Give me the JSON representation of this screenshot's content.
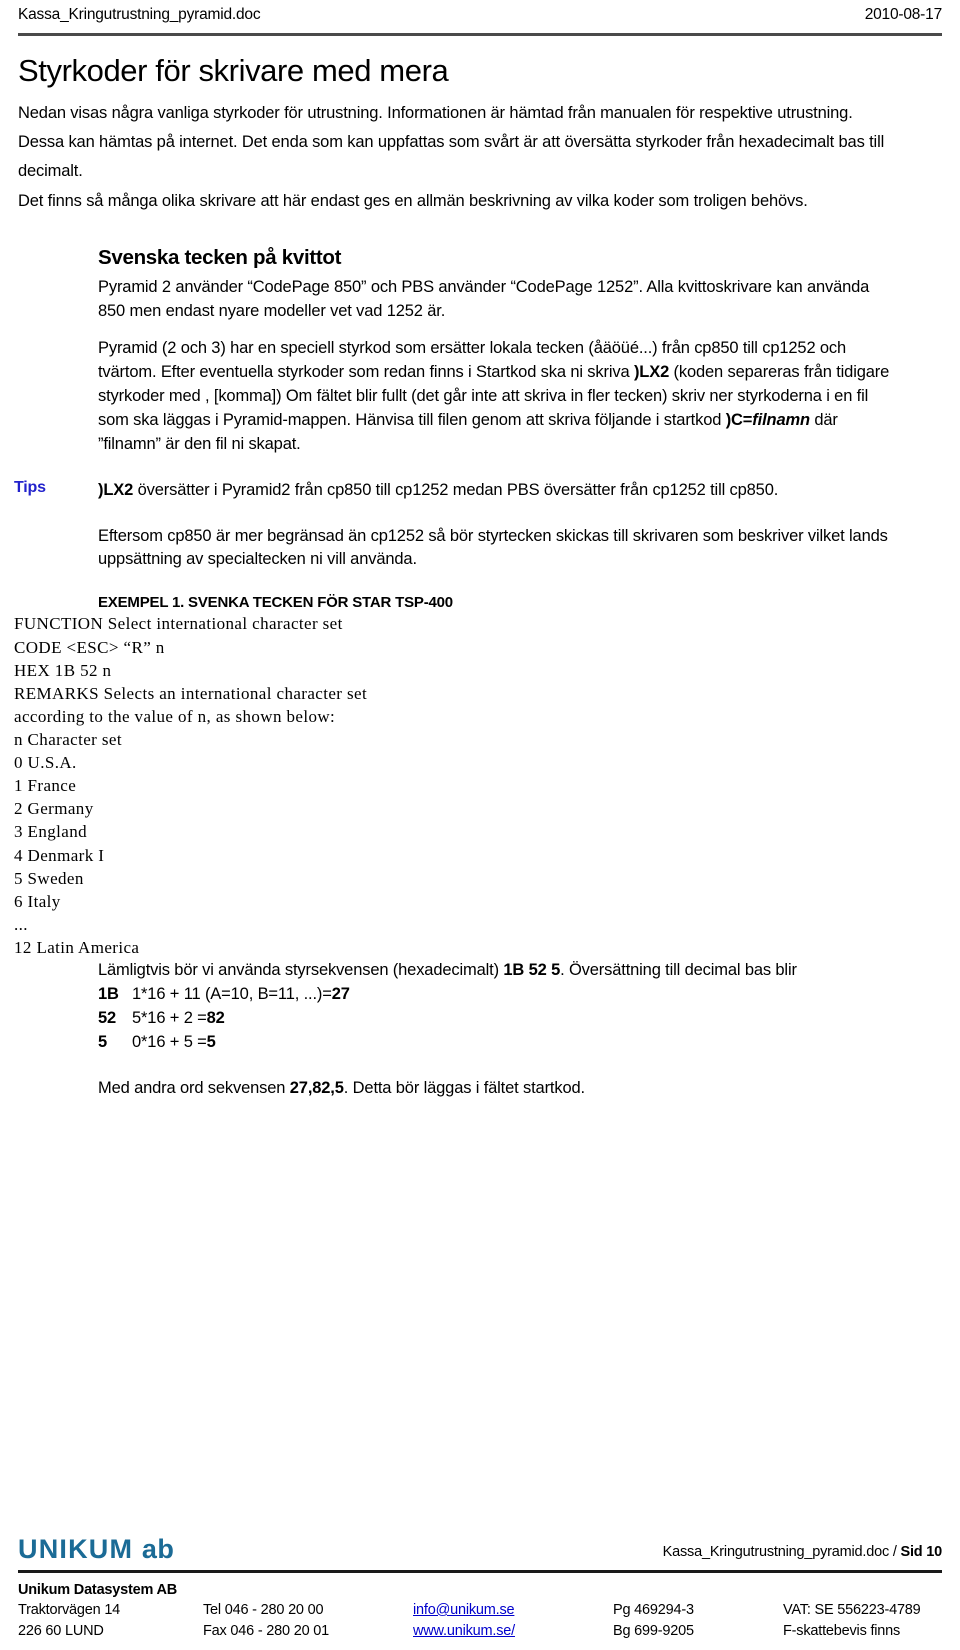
{
  "header": {
    "doc_name": "Kassa_Kringutrustning_pyramid.doc",
    "date": "2010-08-17"
  },
  "title": "Styrkoder för skrivare med mera",
  "intro": {
    "p1": "Nedan visas några vanliga styrkoder för utrustning. Informationen är hämtad från manualen för respektive utrustning. Dessa kan hämtas på internet. Det enda som kan uppfattas som svårt är att översätta styrkoder från hexadecimalt bas till decimalt.",
    "p2": "Det finns så många olika skrivare att här endast ges en allmän beskrivning av vilka koder som troligen behövs."
  },
  "section": {
    "heading": "Svenska tecken på kvittot",
    "p1": "Pyramid 2 använder “CodePage 850” och PBS använder “CodePage 1252”. Alla kvittoskrivare kan använda 850 men endast nyare modeller vet vad 1252 är.",
    "p2_a": "Pyramid (2 och 3) har en speciell styrkod som ersätter lokala tecken (åäöüé...) från cp850 till cp1252 och tvärtom. Efter eventuella styrkoder som redan finns i Startkod ska ni skriva ",
    "p2_b_bold": ")LX2",
    "p2_c": " (koden separeras från tidigare styrkoder med , [komma]) Om fältet blir fullt (det går inte att skriva in fler tecken) skriv ner styrkoderna i en fil som ska läggas i Pyramid-mappen. Hänvisa till filen genom att skriva följande i startkod ",
    "p2_d_bold": ")C=",
    "p2_e_bolditalic": "filnamn",
    "p2_f": " där ”filnamn” är den fil ni skapat."
  },
  "tips": {
    "label": "Tips",
    "p1_bold": ")LX2",
    "p1_rest": " översätter i Pyramid2 från cp850 till cp1252 medan PBS översätter från cp1252 till cp850.",
    "p2": "Eftersom cp850 är mer begränsad än cp1252 så bör styrtecken skickas till skrivaren som beskriver vilket lands uppsättning av specialtecken ni vill använda."
  },
  "example": {
    "heading": "EXEMPEL 1. SVENKA TECKEN FÖR STAR TSP-400",
    "manual_text": "FUNCTION Select international character set\nCODE <ESC> “R” n\nHEX 1B 52 n\nREMARKS Selects an international character set\naccording to the value of n, as shown below:\nn Character set\n0 U.S.A.\n1 France\n2 Germany\n3 England\n4 Denmark I\n5 Sweden\n6 Italy\n...\n12 Latin America",
    "concl_a": "Lämligtvis bör vi använda styrsekvensen (hexadecimalt) ",
    "concl_b_bold": "1B 52 5",
    "concl_c": ". Översättning till decimal bas blir",
    "calc": [
      {
        "key": "1B",
        "expr_a": "1*16 + 11 (A=10, B=11, ...)=",
        "expr_b_bold": "27"
      },
      {
        "key": "52",
        "expr_a": "5*16 + 2 =",
        "expr_b_bold": "82"
      },
      {
        "key": "5",
        "expr_a": "0*16 + 5 =",
        "expr_b_bold": "5"
      }
    ],
    "final_a": "Med andra ord sekvensen ",
    "final_b_bold": "27,82,5",
    "final_c": ". Detta bör läggas i fältet startkod."
  },
  "footer": {
    "logo_main": "UNIKUM",
    "logo_sub": "ab",
    "docref_plain": "Kassa_Kringutrustning_pyramid.doc / ",
    "docref_bold": "Sid 10",
    "company": "Unikum Datasystem AB",
    "rows": [
      {
        "address": "Traktorvägen 14",
        "phone": "Tel  046 - 280 20 00",
        "link": "info@unikum.se",
        "giro": "Pg  469294-3",
        "vat": "VAT: SE 556223-4789"
      },
      {
        "address": "226 60  LUND",
        "phone": "Fax  046 - 280 20 01",
        "link": "www.unikum.se/",
        "giro": "Bg  699-9205",
        "vat": "F-skattebevis finns"
      }
    ]
  },
  "colors": {
    "tips": "#2222CC",
    "logo": "#1B6B96",
    "link": "#0000CC"
  }
}
